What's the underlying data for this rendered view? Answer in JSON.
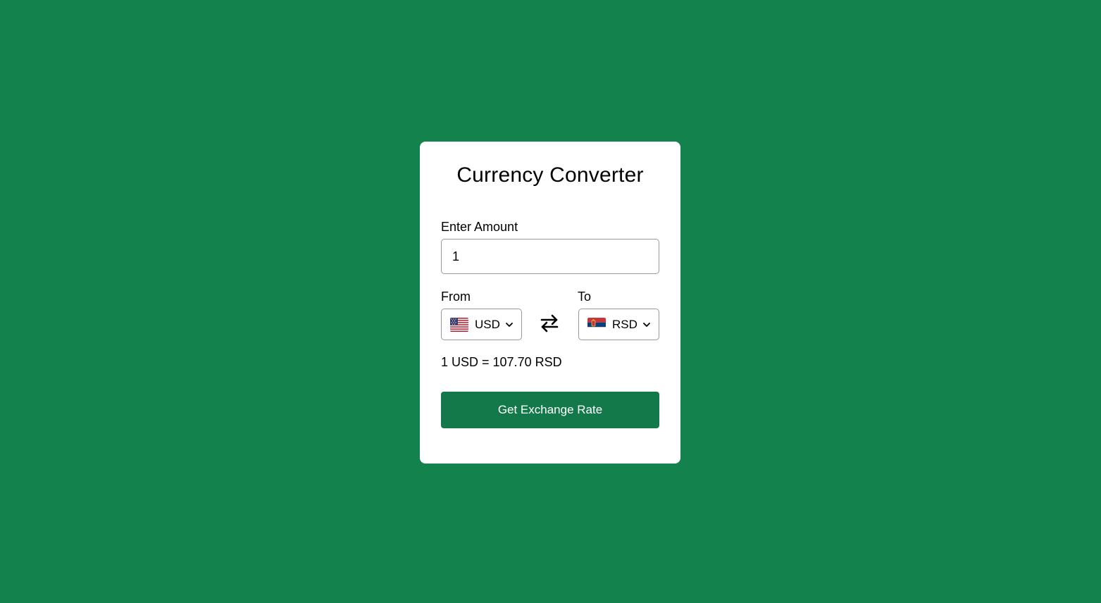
{
  "app": {
    "title": "Currency Converter",
    "background_color": "#13824c",
    "accent_color": "#13784a"
  },
  "amount": {
    "label": "Enter Amount",
    "value": "1"
  },
  "from": {
    "label": "From",
    "selected_code": "USD",
    "flag_icon": "us-flag-icon"
  },
  "to": {
    "label": "To",
    "selected_code": "RSD",
    "flag_icon": "serbia-flag-icon"
  },
  "exchange_rate_text": "1 USD = 107.70 RSD",
  "button": {
    "label": "Get Exchange Rate"
  },
  "icons": {
    "swap": "swap-arrows-icon",
    "dropdown": "chevron-down-icon"
  }
}
